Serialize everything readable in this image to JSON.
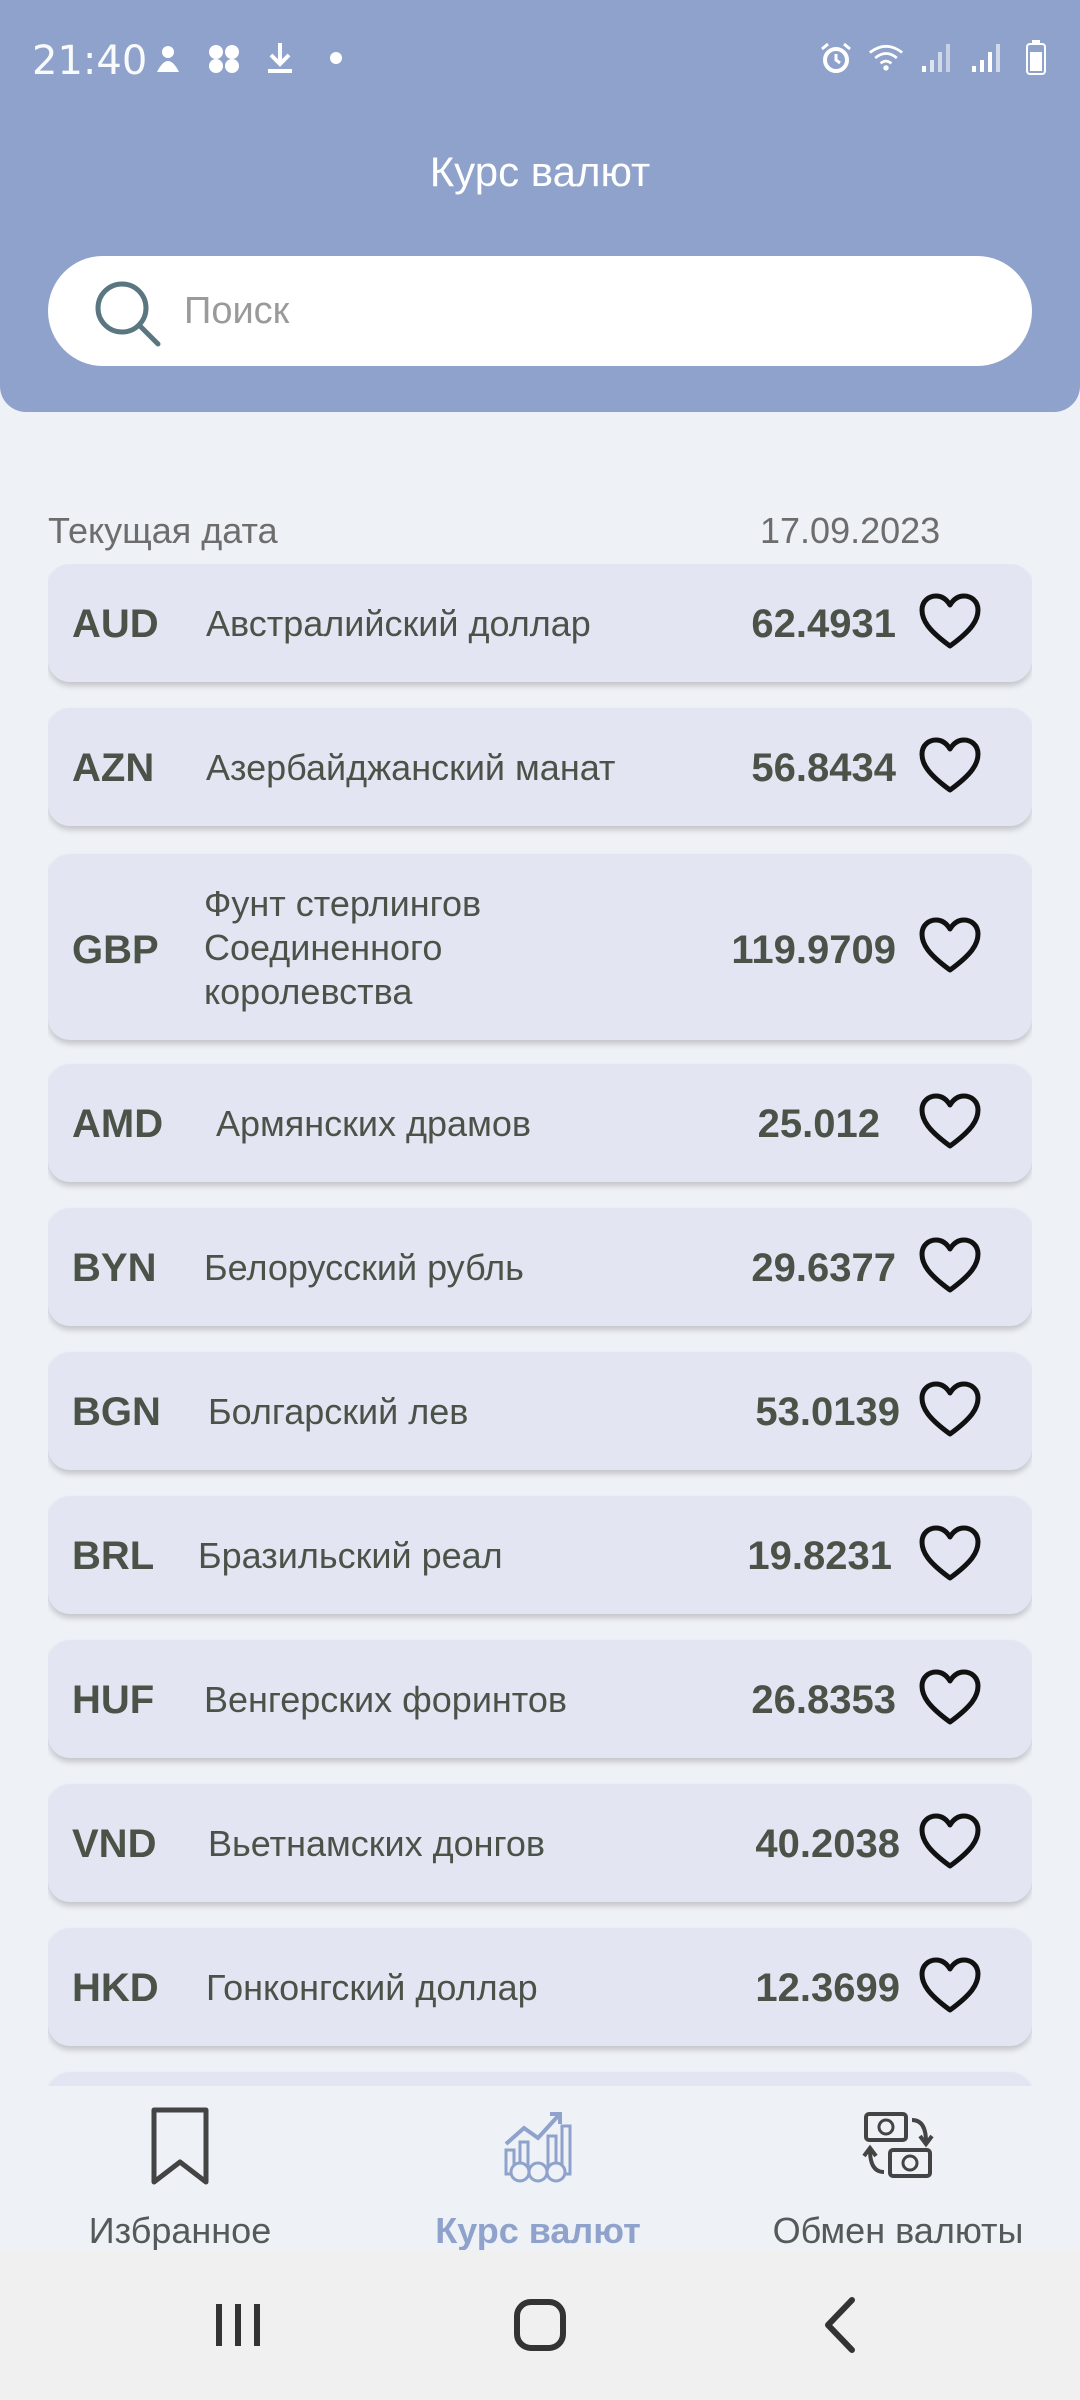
{
  "status_bar": {
    "time": "21:40"
  },
  "header": {
    "title": "Курс валют"
  },
  "search": {
    "placeholder": "Поиск"
  },
  "date": {
    "label": "Текущая дата",
    "value": "17.09.2023"
  },
  "currencies": [
    {
      "code": "AUD",
      "name": "Австралийский доллар",
      "rate": "62.4931"
    },
    {
      "code": "AZN",
      "name": "Азербайджанский манат",
      "rate": "56.8434"
    },
    {
      "code": "GBP",
      "name": "Фунт стерлингов Соединенного королевства",
      "rate": "119.9709"
    },
    {
      "code": "AMD",
      "name": "Армянских драмов",
      "rate": "25.012"
    },
    {
      "code": "BYN",
      "name": "Белорусский рубль",
      "rate": "29.6377"
    },
    {
      "code": "BGN",
      "name": "Болгарский лев",
      "rate": "53.0139"
    },
    {
      "code": "BRL",
      "name": "Бразильский реал",
      "rate": "19.8231"
    },
    {
      "code": "HUF",
      "name": "Венгерских форинтов",
      "rate": "26.8353"
    },
    {
      "code": "VND",
      "name": "Вьетнамских донгов",
      "rate": "40.2038"
    },
    {
      "code": "HKD",
      "name": "Гонконгский доллар",
      "rate": "12.3699"
    }
  ],
  "bottom_nav": {
    "items": [
      {
        "label": "Избранное",
        "icon": "bookmark-icon"
      },
      {
        "label": "Курс валют",
        "icon": "chart-currency-icon"
      },
      {
        "label": "Обмен валюты",
        "icon": "exchange-icon"
      }
    ]
  },
  "colors": {
    "header": "#8ea2cb",
    "card": "#e3e6f2",
    "background": "#eef1f6",
    "active_nav": "#8ea2cb"
  }
}
